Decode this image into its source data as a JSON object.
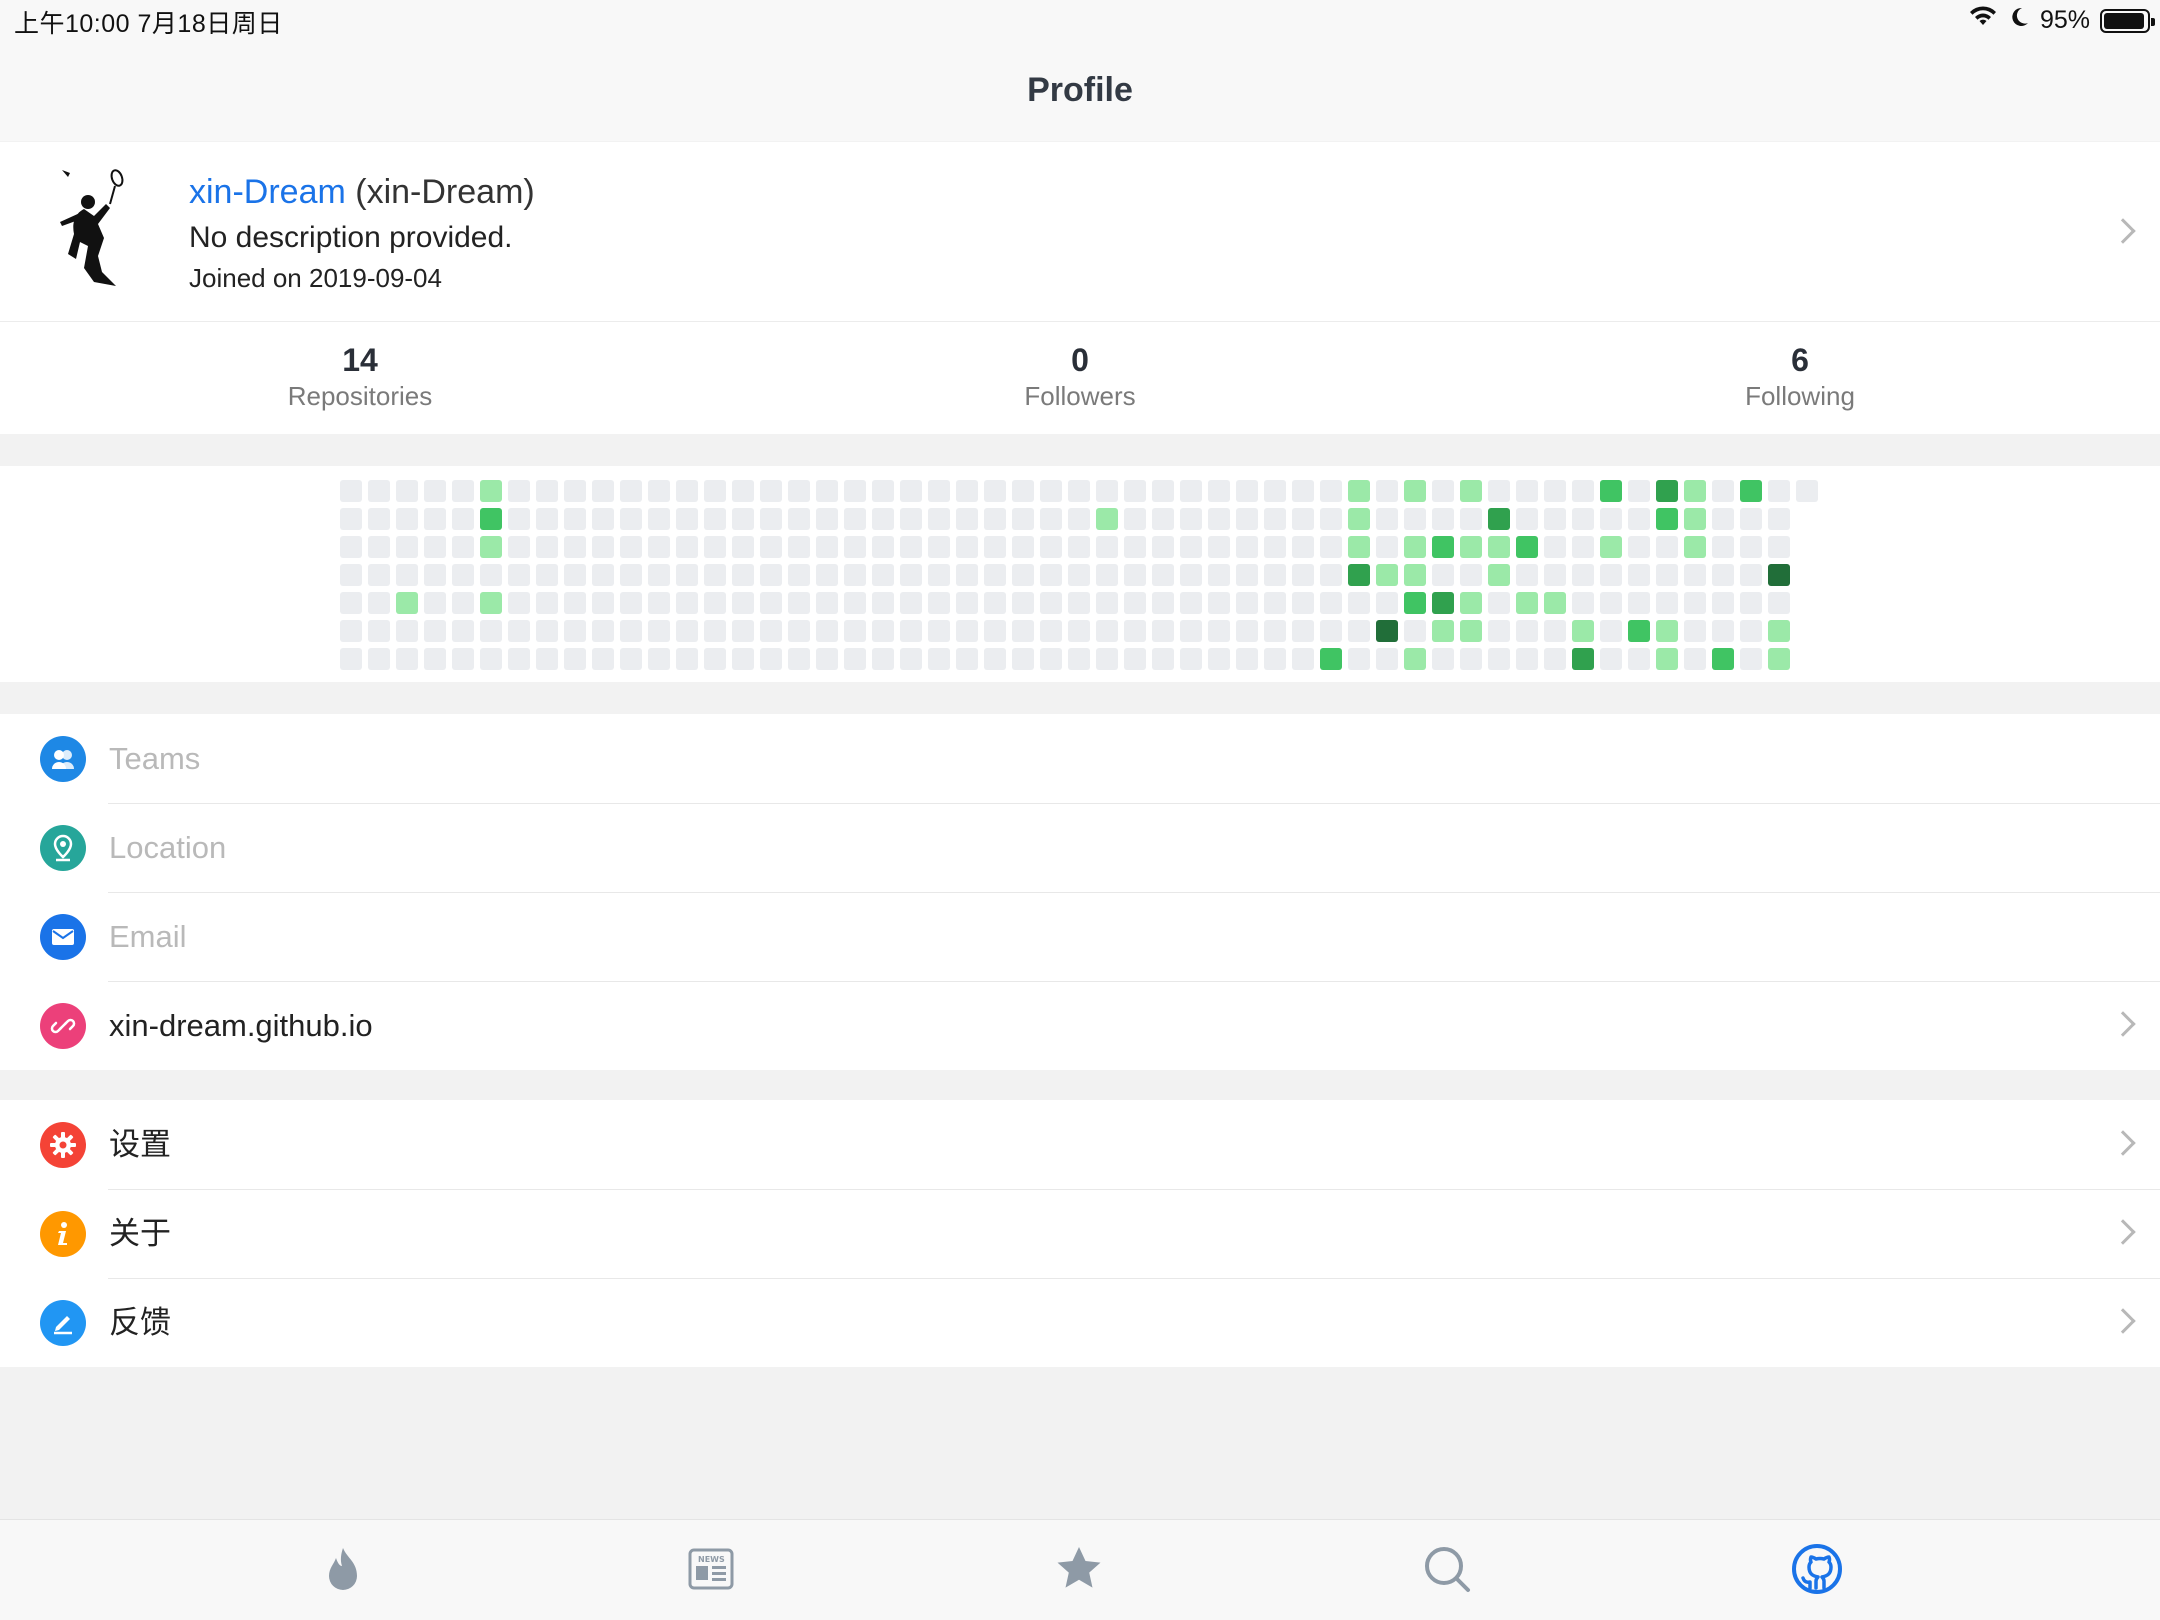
{
  "status_bar": {
    "time": "上午10:00   7月18日周日",
    "battery": "95%",
    "battery_level": 0.95,
    "icons": [
      "wifi-icon",
      "moon-icon",
      "battery-icon"
    ]
  },
  "nav": {
    "title": "Profile"
  },
  "profile": {
    "login": "xin-Dream",
    "name": "(xin-Dream)",
    "description": "No description provided.",
    "joined": "Joined on 2019-09-04"
  },
  "stats": [
    {
      "value": "14",
      "label": "Repositories"
    },
    {
      "value": "0",
      "label": "Followers"
    },
    {
      "value": "6",
      "label": "Following"
    }
  ],
  "contributions": {
    "colors": {
      "0": "#ebedf0",
      "1": "#9be9a8",
      "2": "#40c463",
      "3": "#30a14e",
      "4": "#216e39"
    },
    "weeks": 53,
    "active_cells": [
      [
        5,
        0,
        1
      ],
      [
        5,
        1,
        2
      ],
      [
        5,
        2,
        1
      ],
      [
        5,
        4,
        1
      ],
      [
        2,
        4,
        1
      ],
      [
        27,
        1,
        1
      ],
      [
        36,
        0,
        1
      ],
      [
        36,
        1,
        1
      ],
      [
        36,
        2,
        1
      ],
      [
        36,
        3,
        3
      ],
      [
        35,
        6,
        2
      ],
      [
        37,
        3,
        1
      ],
      [
        37,
        5,
        4
      ],
      [
        38,
        0,
        1
      ],
      [
        38,
        2,
        1
      ],
      [
        38,
        3,
        1
      ],
      [
        38,
        4,
        2
      ],
      [
        38,
        6,
        1
      ],
      [
        39,
        2,
        2
      ],
      [
        39,
        4,
        3
      ],
      [
        39,
        5,
        1
      ],
      [
        40,
        0,
        1
      ],
      [
        40,
        2,
        1
      ],
      [
        40,
        4,
        1
      ],
      [
        40,
        5,
        1
      ],
      [
        41,
        1,
        3
      ],
      [
        41,
        2,
        1
      ],
      [
        41,
        3,
        1
      ],
      [
        42,
        2,
        2
      ],
      [
        42,
        4,
        1
      ],
      [
        43,
        4,
        1
      ],
      [
        44,
        5,
        1
      ],
      [
        44,
        6,
        3
      ],
      [
        45,
        0,
        2
      ],
      [
        45,
        2,
        1
      ],
      [
        46,
        5,
        2
      ],
      [
        47,
        0,
        3
      ],
      [
        47,
        1,
        2
      ],
      [
        47,
        5,
        1
      ],
      [
        47,
        6,
        1
      ],
      [
        48,
        0,
        1
      ],
      [
        48,
        1,
        1
      ],
      [
        48,
        2,
        1
      ],
      [
        49,
        6,
        2
      ],
      [
        50,
        0,
        2
      ],
      [
        51,
        3,
        4
      ],
      [
        51,
        5,
        1
      ],
      [
        51,
        6,
        1
      ]
    ]
  },
  "info_list": [
    {
      "label": "Teams",
      "icon": "teams-icon",
      "color": "#1e88e5",
      "muted": true
    },
    {
      "label": "Location",
      "icon": "location-icon",
      "color": "#26a69a",
      "muted": true
    },
    {
      "label": "Email",
      "icon": "email-icon",
      "color": "#1a73e8",
      "muted": true
    },
    {
      "label": "xin-dream.github.io",
      "icon": "link-icon",
      "color": "#ec407a",
      "muted": false
    }
  ],
  "settings_list": [
    {
      "label": "设置",
      "icon": "gear-icon",
      "color": "#f44336"
    },
    {
      "label": "关于",
      "icon": "info-icon",
      "color": "#ff9800"
    },
    {
      "label": "反馈",
      "icon": "edit-icon",
      "color": "#2196f3"
    }
  ],
  "tabs": [
    {
      "icon": "flame-icon"
    },
    {
      "icon": "news-icon",
      "text": "NEWS"
    },
    {
      "icon": "star-icon"
    },
    {
      "icon": "search-icon"
    },
    {
      "icon": "github-icon",
      "active": true
    }
  ]
}
